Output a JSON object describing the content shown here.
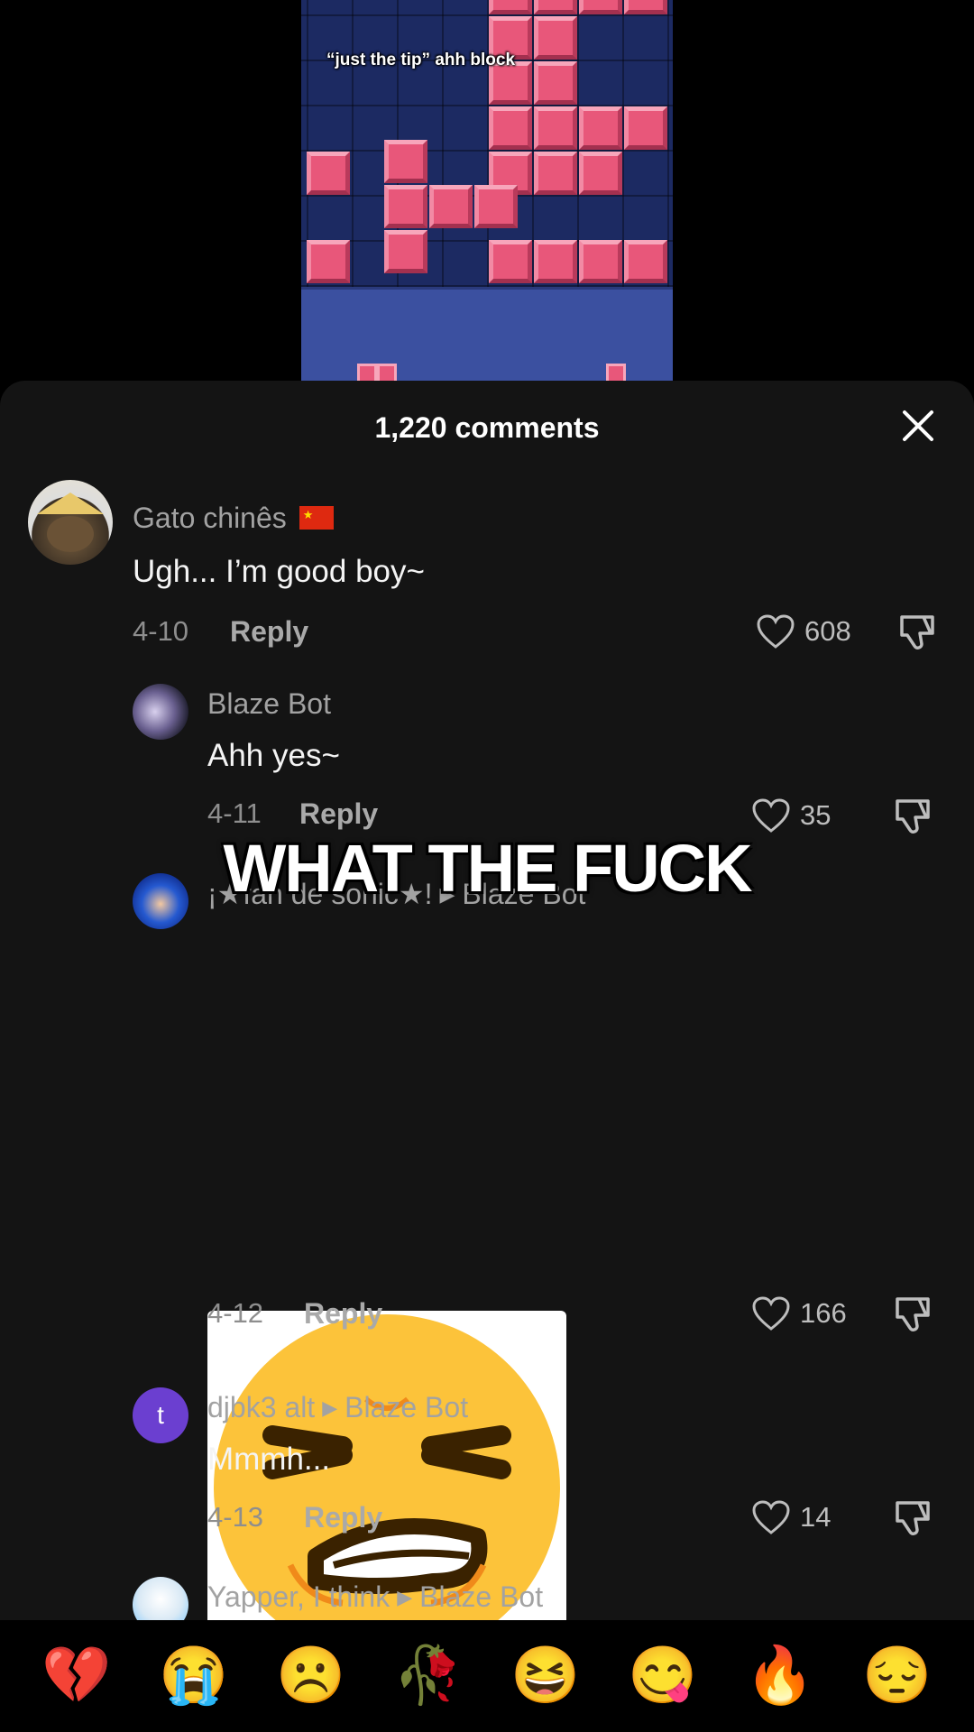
{
  "video": {
    "caption": "“just the tip” ahh block"
  },
  "overlay_text": "WHAT THE FUCK",
  "sheet": {
    "title": "1,220 comments"
  },
  "comments": [
    {
      "user": "Gato chinês",
      "text": "Ugh... I’m good boy~",
      "date": "4-10",
      "reply": "Reply",
      "likes": "608"
    },
    {
      "user": "Blaze Bot",
      "text": "Ahh yes~",
      "date": "4-11",
      "reply": "Reply",
      "likes": "35"
    },
    {
      "user": "¡★fan de sonic★!",
      "reply_to": "Blaze Bot",
      "date": "4-12",
      "reply": "Reply",
      "likes": "166"
    },
    {
      "user": "djbk3 alt",
      "reply_to": "Blaze Bot",
      "text": "Mmmh...",
      "date": "4-13",
      "reply": "Reply",
      "likes": "14",
      "avatar_letter": "t"
    },
    {
      "user": "Yapper, I think",
      "reply_to": "Blaze Bot"
    }
  ],
  "emoji_bar": [
    "💔",
    "😭",
    "☹️",
    "🥀",
    "😆",
    "😋",
    "🔥",
    "😔"
  ]
}
